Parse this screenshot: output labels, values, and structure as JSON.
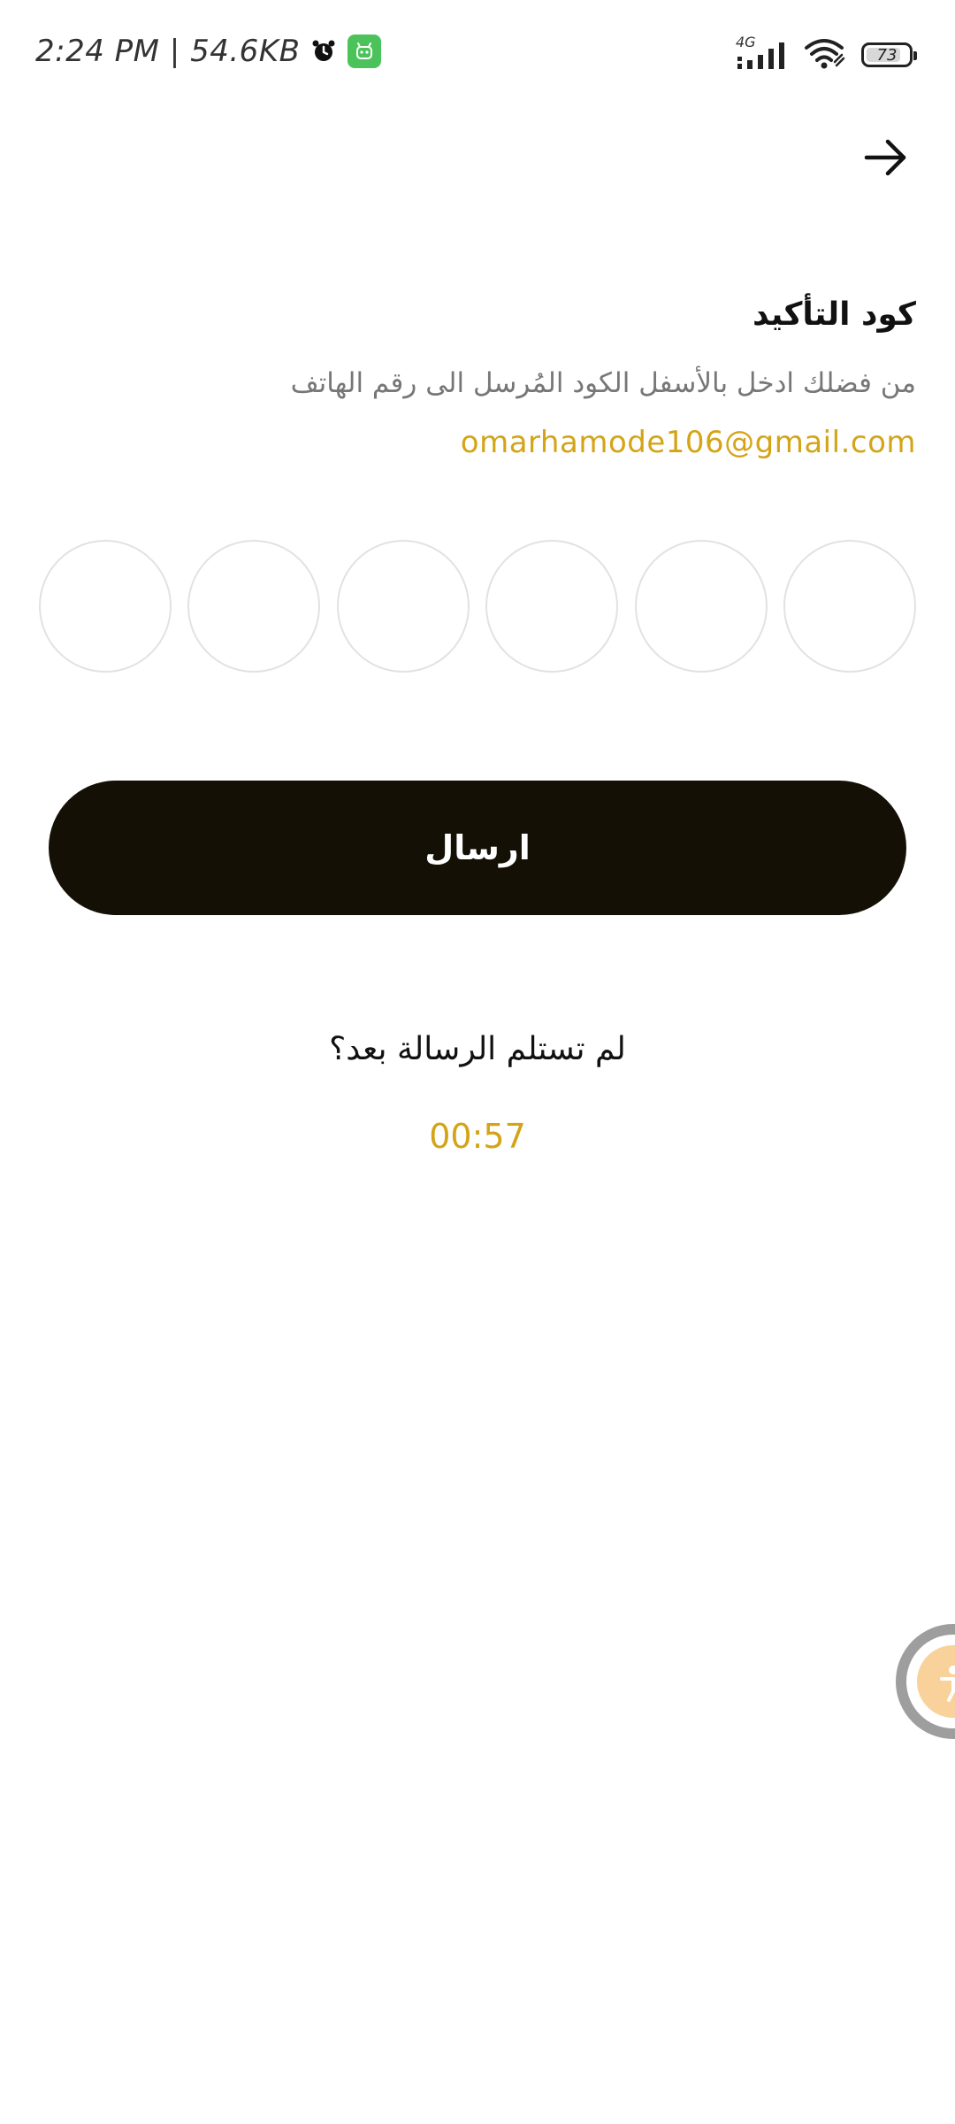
{
  "status_bar": {
    "time_text": "2:24 PM | 54.6KB",
    "network_label": "4G",
    "battery_level": "73"
  },
  "header": {
    "back_icon": "arrow-right-icon"
  },
  "verification": {
    "title": "كود التأكيد",
    "subtitle": "من فضلك ادخل بالأسفل الكود المُرسل الى رقم الهاتف",
    "email": "omarhamode106@gmail.com",
    "otp_length": 6
  },
  "actions": {
    "send_label": "ارسال"
  },
  "resend": {
    "question": "لم تستلم الرسالة بعد؟",
    "timer": "00:57"
  },
  "colors": {
    "accent": "#d4a417",
    "button_bg": "#141005",
    "circle_border": "#e2e2e2"
  }
}
